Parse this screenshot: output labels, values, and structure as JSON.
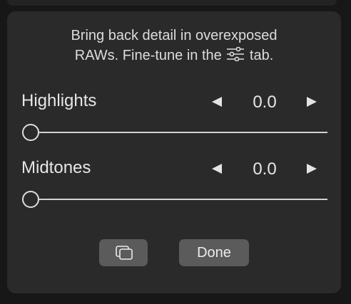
{
  "hint": {
    "line1": "Bring back detail in overexposed",
    "line2_before": "RAWs. Fine-tune in the",
    "line2_after": "tab.",
    "icon": "sliders-icon"
  },
  "sliders": [
    {
      "label": "Highlights",
      "value": "0.0",
      "level": 0.0
    },
    {
      "label": "Midtones",
      "value": "0.0",
      "level": 0.0
    }
  ],
  "buttons": {
    "compare_icon": "compare-icon",
    "done_label": "Done"
  },
  "colors": {
    "panel": "#2a2a2b",
    "background": "#171717",
    "button": "#5b5b5c",
    "text": "#e6e6e6"
  }
}
